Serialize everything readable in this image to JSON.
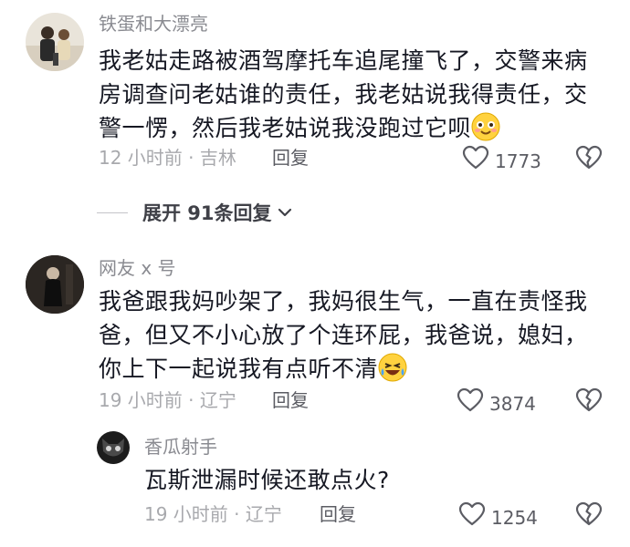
{
  "comments": [
    {
      "username": "铁蛋和大漂亮",
      "text": "我老姑走路被酒驾摩托车追尾撞飞了，交警来病房调查问老姑谁的责任，我老姑说我得责任，交警一愣，然后我老姑说我没跑过它呗",
      "emoji": "smile-emoji",
      "meta": "12 小时前 · 吉林",
      "reply_label": "回复",
      "likes": "1773"
    },
    {
      "username": "网友 x 号",
      "text": "我爸跟我妈吵架了，我妈很生气，一直在责怪我爸，但又不小心放了个连环屁，我爸说，媳妇，你上下一起说我有点听不清",
      "emoji": "laugh-tears-emoji",
      "meta": "19 小时前 · 辽宁",
      "reply_label": "回复",
      "likes": "3874"
    }
  ],
  "expand_replies": {
    "label": "展开 91条回复"
  },
  "sub_reply": {
    "username": "香瓜射手",
    "text": "瓦斯泄漏时候还敢点火?",
    "meta": "19 小时前 · 辽宁",
    "reply_label": "回复",
    "likes": "1254"
  }
}
